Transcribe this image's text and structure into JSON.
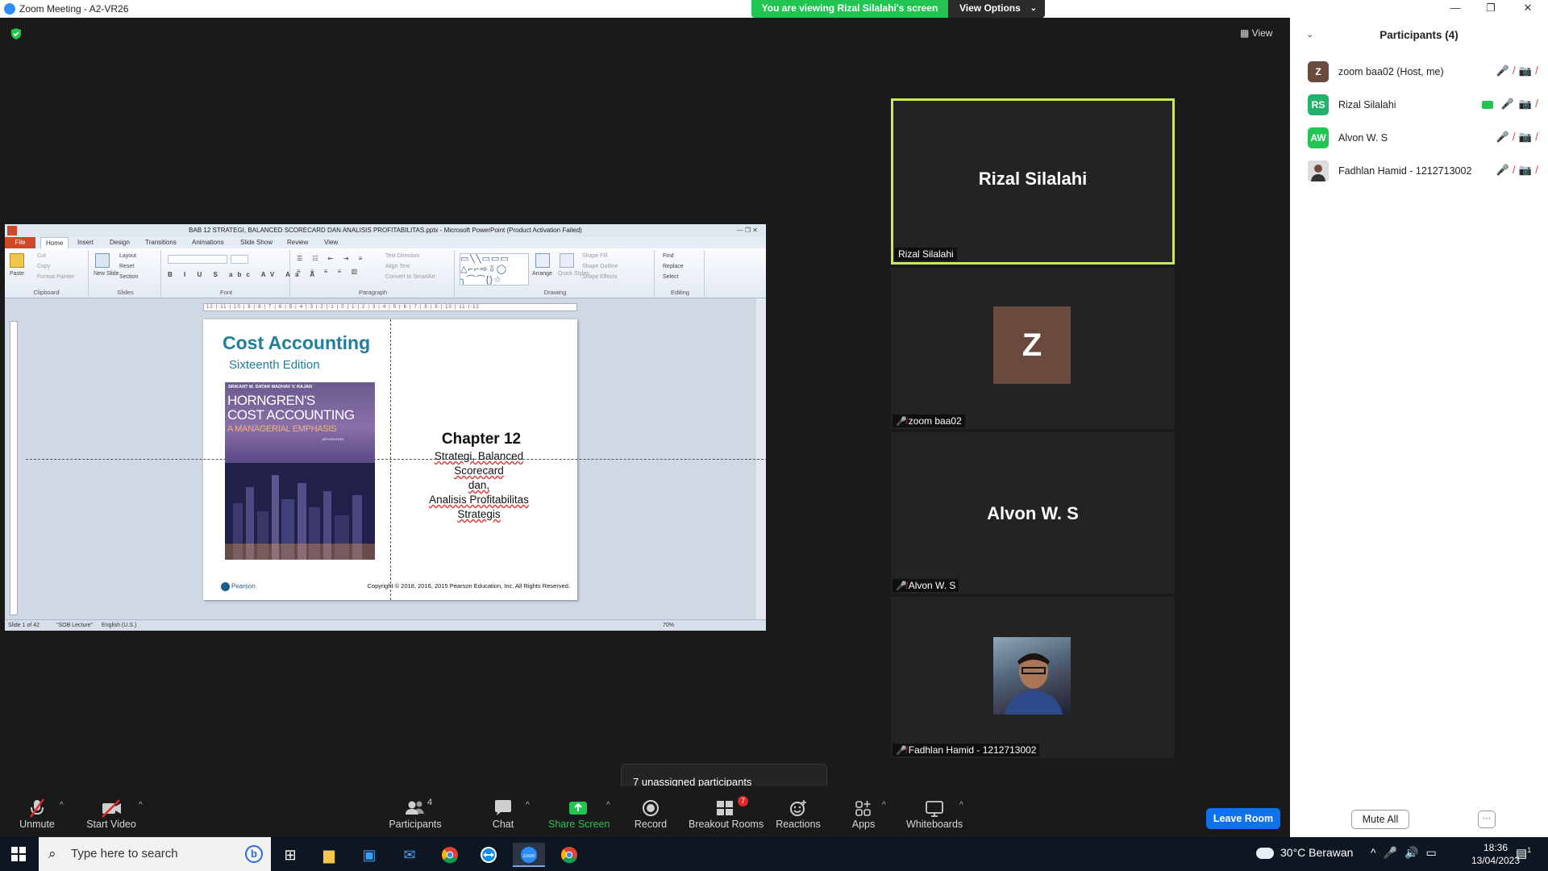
{
  "window": {
    "title": "Zoom Meeting - A2-VR26",
    "minimize": "—",
    "maximize": "❐",
    "close": "✕"
  },
  "banner": {
    "viewing_text": "You are viewing Rizal Silalahi's screen",
    "view_options": "View Options",
    "view_options_chevron": "⌄"
  },
  "stage": {
    "view_label": "View"
  },
  "shared_screen": {
    "window_title": "BAB 12 STRATEGI, BALANCED SCORECARD DAN ANALISIS PROFITABILITAS.pptx  -  Microsoft PowerPoint (Product Activation Failed)",
    "tabs": [
      "File",
      "Home",
      "Insert",
      "Design",
      "Transitions",
      "Animations",
      "Slide Show",
      "Review",
      "View"
    ],
    "ribbon": {
      "paste": "Paste",
      "cut": "Cut",
      "copy": "Copy",
      "format_painter": "Format Painter",
      "clipboard": "Clipboard",
      "new_slide": "New Slide",
      "layout": "Layout",
      "reset": "Reset",
      "section": "Section",
      "slides": "Slides",
      "font": "Font",
      "text_direction": "Text Direction",
      "align_text": "Align Text",
      "convert_smartart": "Convert to SmartArt",
      "paragraph": "Paragraph",
      "arrange": "Arrange",
      "quick_styles": "Quick Styles",
      "shape_fill": "Shape Fill",
      "shape_outline": "Shape Outline",
      "shape_effects": "Shape Effects",
      "drawing": "Drawing",
      "find": "Find",
      "replace": "Replace",
      "select": "Select",
      "editing": "Editing"
    },
    "ruler_text": "·12·|·11·|·10·|·9·|·8·|·7·|·6·|·5·|·4·|·3·|·2·|·1·|·0·|·1·|·2·|·3·|·4·|·5·|·6·|·7·|·8·|·9·|·10·|·11·|·12·",
    "slide": {
      "title": "Cost Accounting",
      "edition": "Sixteenth  Edition",
      "book_authors": "SRIKANT M. DATAR   MADHAV V. RAJAN",
      "book_title_1": "HORNGREN'S",
      "book_title_2": "COST ACCOUNTING",
      "book_subtitle": "A MANAGERIAL EMPHASIS",
      "book_edition": "16TH EDITION",
      "chapter": "Chapter 12",
      "lines": [
        "Strategi,  Balanced",
        "Scorecard",
        "dan,",
        "Analisis  Profitabilitas",
        "Strategis"
      ],
      "publisher": "Pearson",
      "copyright": "Copyright © 2018, 2016, 2015 Pearson Education, Inc. All Rights Reserved."
    },
    "status": {
      "slide_count": "Slide 1 of 42",
      "theme": "\"SOB Lecture\"",
      "language": "English (U.S.)",
      "zoom": "70%"
    }
  },
  "video_tiles": [
    {
      "big_name": "Rizal Silalahi",
      "name_tag": "Rizal Silalahi",
      "active": true,
      "muted": false
    },
    {
      "avatar_letter": "Z",
      "name_tag": "zoom baa02",
      "muted": true
    },
    {
      "big_name": "Alvon W. S",
      "name_tag": "Alvon W. S",
      "muted": true
    },
    {
      "name_tag": "Fadhlan Hamid - 1212713002",
      "muted": true
    }
  ],
  "toast": {
    "text": "7 unassigned participants"
  },
  "toolbar": {
    "unmute": "Unmute",
    "start_video": "Start Video",
    "participants": "Participants",
    "participants_count": "4",
    "chat": "Chat",
    "share_screen": "Share Screen",
    "record": "Record",
    "breakout_rooms": "Breakout Rooms",
    "breakout_badge": "7",
    "reactions": "Reactions",
    "apps": "Apps",
    "whiteboards": "Whiteboards",
    "leave_room": "Leave Room"
  },
  "participants_panel": {
    "title": "Participants (4)",
    "items": [
      {
        "initials": "Z",
        "name": "zoom baa02 (Host, me)",
        "color": "#6b4a3e"
      },
      {
        "initials": "RS",
        "name": "Rizal Silalahi",
        "color": "#23b26d"
      },
      {
        "initials": "AW",
        "name": "Alvon W. S",
        "color": "#23c552"
      },
      {
        "initials": "",
        "name": "Fadhlan Hamid - 1212713002",
        "color": "#5a4a44"
      }
    ],
    "mute_all": "Mute All",
    "more": "···"
  },
  "taskbar": {
    "search_placeholder": "Type here to search",
    "weather": "30°C  Berawan",
    "time": "18:36",
    "date": "13/04/2023",
    "notifications": "1"
  },
  "colors": {
    "zoom_blue": "#0e72ed",
    "green": "#23c552",
    "muted_red": "#e02828",
    "active_border": "#c9e85a"
  }
}
